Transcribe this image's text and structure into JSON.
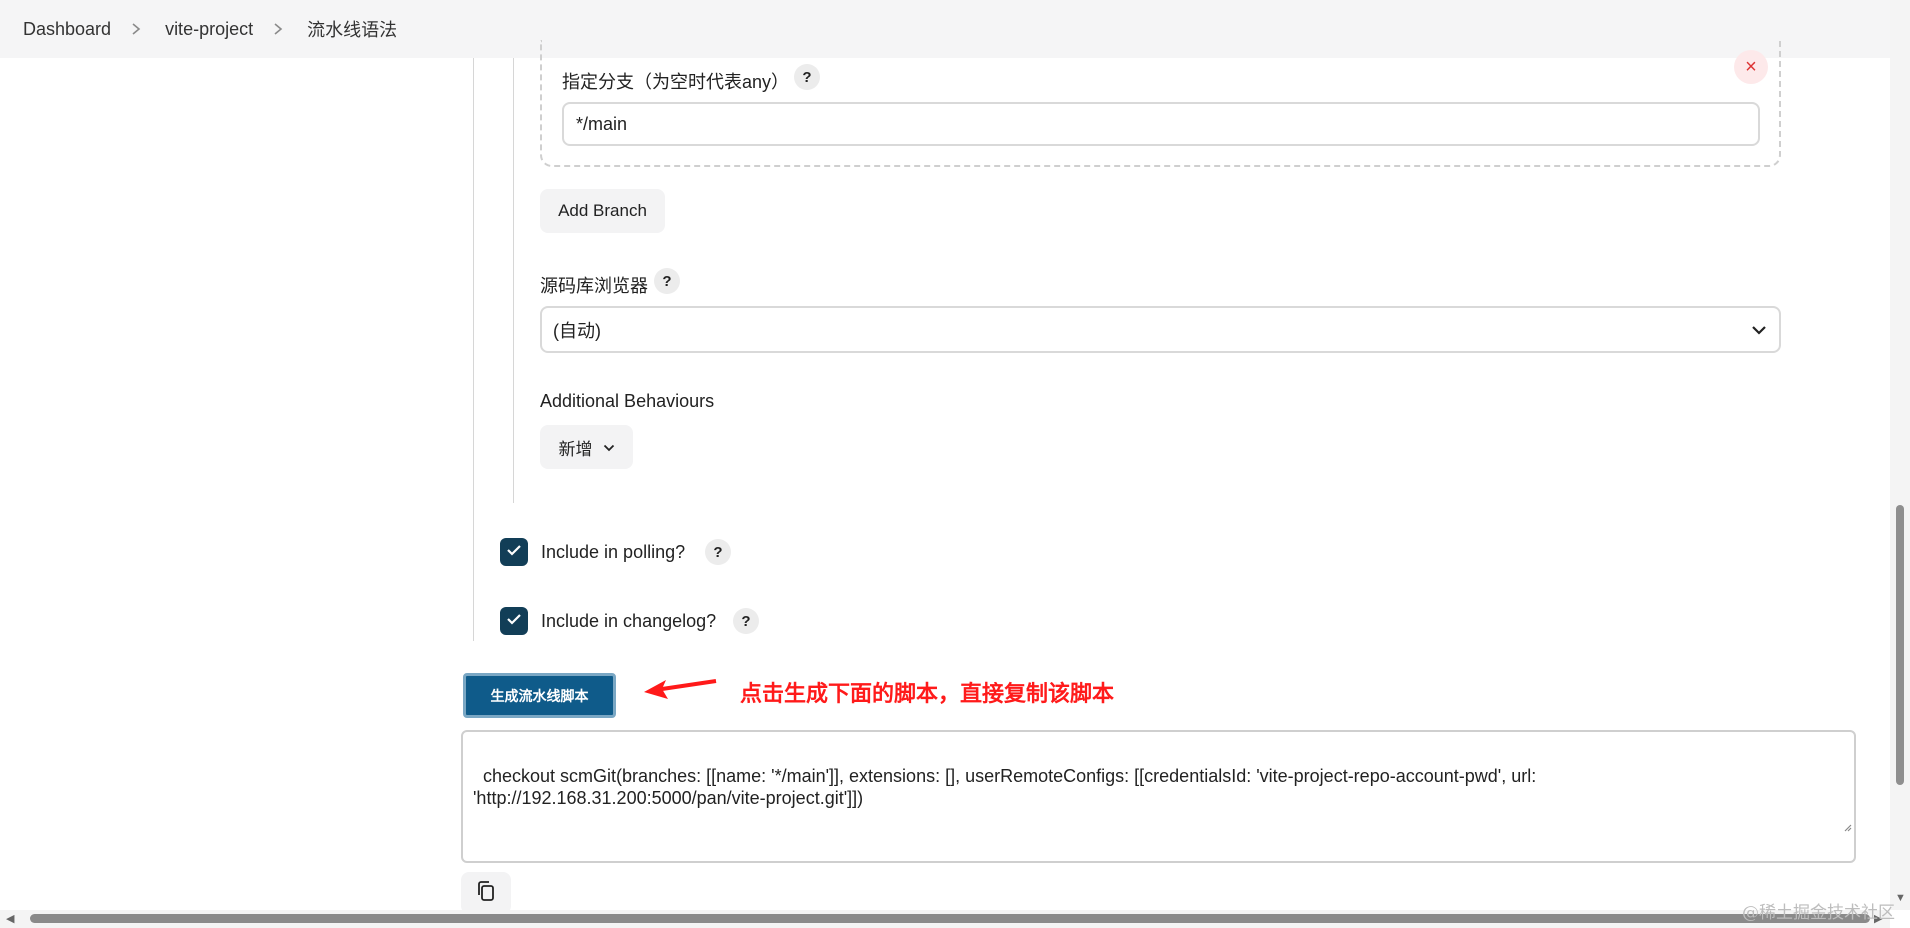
{
  "breadcrumb": {
    "items": [
      "Dashboard",
      "vite-project",
      "流水线语法"
    ]
  },
  "branch_spec": {
    "label": "指定分支（为空时代表any）",
    "help": "?",
    "close": "×",
    "value": "*/main"
  },
  "add_branch": {
    "label": "Add Branch"
  },
  "repo_browser": {
    "label": "源码库浏览器",
    "help": "?",
    "selected": "(自动)"
  },
  "additional_behaviours": {
    "label": "Additional Behaviours",
    "add_label": "新增"
  },
  "polling": {
    "label": "Include in polling?",
    "checked": true,
    "help": "?"
  },
  "changelog": {
    "label": "Include in changelog?",
    "checked": true,
    "help": "?"
  },
  "generate_button": {
    "label": "生成流水线脚本"
  },
  "annotation": {
    "text": "点击生成下面的脚本，直接复制该脚本"
  },
  "script_output": {
    "text": "checkout scmGit(branches: [[name: '*/main']], extensions: [], userRemoteConfigs: [[credentialsId: 'vite-project-repo-account-pwd', url:\n'http://192.168.31.200:5000/pan/vite-project.git']])"
  },
  "watermark": "@稀土掘金技术社区",
  "colors": {
    "primary_button": "#0f5b8a",
    "checkbox": "#123e57",
    "annotation": "#ff1a1a",
    "breadcrumb_bg": "#f5f5f6"
  },
  "icons": {
    "breadcrumb_separator": "chevron-right-icon",
    "select": "chevron-down-icon",
    "checkbox": "checkmark-icon",
    "copy": "copy-icon",
    "close": "close-icon",
    "annotation_arrow": "arrow-left-icon"
  }
}
